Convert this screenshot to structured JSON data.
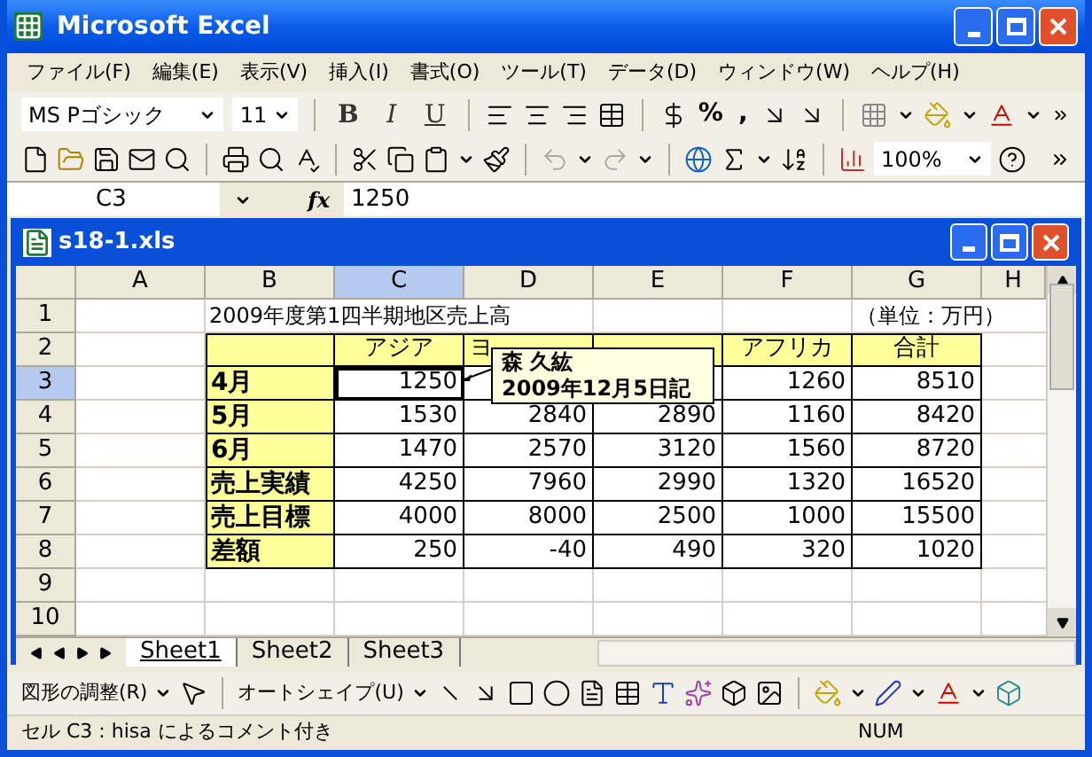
{
  "window": {
    "title": "Microsoft Excel"
  },
  "menu": [
    "ファイル(F)",
    "編集(E)",
    "表示(V)",
    "挿入(I)",
    "書式(O)",
    "ツール(T)",
    "データ(D)",
    "ウィンドウ(W)",
    "ヘルプ(H)"
  ],
  "format_toolbar": {
    "font": "MS Pゴシック",
    "size": "11",
    "styles": [
      "B",
      "I",
      "U"
    ],
    "percent": "%",
    "comma": ","
  },
  "standard_toolbar": {
    "zoom": "100%"
  },
  "formula_bar": {
    "name_box": "C3",
    "fx": "fx",
    "value": "1250"
  },
  "workbook": {
    "title": "s18-1.xls",
    "columns": [
      {
        "label": "A",
        "selected": false
      },
      {
        "label": "B",
        "selected": false
      },
      {
        "label": "C",
        "selected": true
      },
      {
        "label": "D",
        "selected": false
      },
      {
        "label": "E",
        "selected": false
      },
      {
        "label": "F",
        "selected": false
      },
      {
        "label": "G",
        "selected": false
      },
      {
        "label": "H",
        "selected": false
      }
    ],
    "rows": [
      {
        "label": "1",
        "selected": false,
        "cells": [
          {
            "kind": "blank"
          },
          {
            "kind": "title",
            "text": "2009年度第1四半期地区売上高"
          },
          {
            "kind": "blank"
          },
          {
            "kind": "blank"
          },
          {
            "kind": "blank"
          },
          {
            "kind": "blank"
          },
          {
            "kind": "note",
            "text": "（単位：万円）"
          },
          {
            "kind": "blank"
          }
        ]
      },
      {
        "label": "2",
        "selected": false,
        "cells": [
          {
            "kind": "blank"
          },
          {
            "kind": "corner"
          },
          {
            "kind": "header",
            "text": "アジア"
          },
          {
            "kind": "header_partial",
            "text": "ヨ"
          },
          {
            "kind": "header"
          },
          {
            "kind": "header",
            "text": "アフリカ"
          },
          {
            "kind": "header",
            "text": "合計"
          },
          {
            "kind": "blank"
          }
        ]
      },
      {
        "label": "3",
        "selected": true,
        "cells": [
          {
            "kind": "blank"
          },
          {
            "kind": "label",
            "text": "4月"
          },
          {
            "kind": "number",
            "text": "1250",
            "active": true
          },
          {
            "kind": "number"
          },
          {
            "kind": "number"
          },
          {
            "kind": "number",
            "text": "1260"
          },
          {
            "kind": "number",
            "text": "8510"
          },
          {
            "kind": "blank"
          }
        ]
      },
      {
        "label": "4",
        "selected": false,
        "cells": [
          {
            "kind": "blank"
          },
          {
            "kind": "label",
            "text": "5月"
          },
          {
            "kind": "number",
            "text": "1530"
          },
          {
            "kind": "number",
            "text": "2840"
          },
          {
            "kind": "number",
            "text": "2890"
          },
          {
            "kind": "number",
            "text": "1160"
          },
          {
            "kind": "number",
            "text": "8420"
          },
          {
            "kind": "blank"
          }
        ]
      },
      {
        "label": "5",
        "selected": false,
        "cells": [
          {
            "kind": "blank"
          },
          {
            "kind": "label",
            "text": "6月"
          },
          {
            "kind": "number",
            "text": "1470"
          },
          {
            "kind": "number",
            "text": "2570"
          },
          {
            "kind": "number",
            "text": "3120"
          },
          {
            "kind": "number",
            "text": "1560"
          },
          {
            "kind": "number",
            "text": "8720"
          },
          {
            "kind": "blank"
          }
        ]
      },
      {
        "label": "6",
        "selected": false,
        "cells": [
          {
            "kind": "blank"
          },
          {
            "kind": "label",
            "text": "売上実績"
          },
          {
            "kind": "number",
            "text": "4250"
          },
          {
            "kind": "number",
            "text": "7960"
          },
          {
            "kind": "number",
            "text": "2990"
          },
          {
            "kind": "number",
            "text": "1320"
          },
          {
            "kind": "number",
            "text": "16520"
          },
          {
            "kind": "blank"
          }
        ]
      },
      {
        "label": "7",
        "selected": false,
        "cells": [
          {
            "kind": "blank"
          },
          {
            "kind": "label",
            "text": "売上目標"
          },
          {
            "kind": "number",
            "text": "4000"
          },
          {
            "kind": "number",
            "text": "8000"
          },
          {
            "kind": "number",
            "text": "2500"
          },
          {
            "kind": "number",
            "text": "1000"
          },
          {
            "kind": "number",
            "text": "15500"
          },
          {
            "kind": "blank"
          }
        ]
      },
      {
        "label": "8",
        "selected": false,
        "cells": [
          {
            "kind": "blank"
          },
          {
            "kind": "label",
            "text": "差額"
          },
          {
            "kind": "number",
            "text": "250"
          },
          {
            "kind": "number",
            "text": "-40"
          },
          {
            "kind": "number",
            "text": "490"
          },
          {
            "kind": "number",
            "text": "320"
          },
          {
            "kind": "number",
            "text": "1020"
          },
          {
            "kind": "blank"
          }
        ]
      },
      {
        "label": "9",
        "selected": false,
        "cells": [
          {
            "kind": "blank"
          },
          {
            "kind": "blank"
          },
          {
            "kind": "blank"
          },
          {
            "kind": "blank"
          },
          {
            "kind": "blank"
          },
          {
            "kind": "blank"
          },
          {
            "kind": "blank"
          },
          {
            "kind": "blank"
          }
        ]
      },
      {
        "label": "10",
        "selected": false,
        "cells": [
          {
            "kind": "blank"
          },
          {
            "kind": "blank"
          },
          {
            "kind": "blank"
          },
          {
            "kind": "blank"
          },
          {
            "kind": "blank"
          },
          {
            "kind": "blank"
          },
          {
            "kind": "blank"
          },
          {
            "kind": "blank"
          }
        ]
      }
    ],
    "comment": {
      "author": "森 久紘",
      "date": "2009年12月5日記"
    },
    "sheets": [
      {
        "label": "Sheet1",
        "selected": true
      },
      {
        "label": "Sheet2",
        "selected": false
      },
      {
        "label": "Sheet3",
        "selected": false
      }
    ]
  },
  "drawing_toolbar": {
    "draw_menu": "図形の調整(R)",
    "autoshapes": "オートシェイプ(U)"
  },
  "status_bar": {
    "message": "セル C3 : hisa によるコメント付き",
    "mode": "NUM"
  }
}
